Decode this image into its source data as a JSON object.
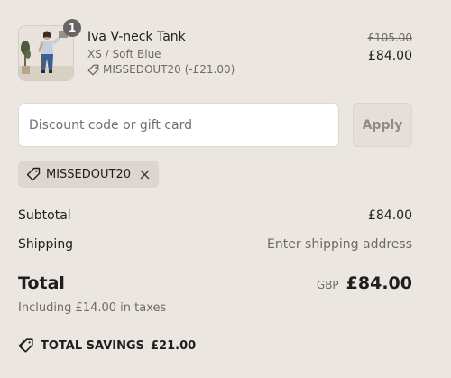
{
  "product": {
    "name": "Iva V-neck Tank",
    "variant": "XS / Soft Blue",
    "discount_applied": "MISSEDOUT20 (-£21.00)",
    "compare_at_price": "£105.00",
    "price": "£84.00",
    "quantity": "1",
    "image_alt": "Iva V-neck Tank product photo",
    "icons": [
      "tag-icon"
    ]
  },
  "discount": {
    "placeholder": "Discount code or gift card",
    "value": "",
    "apply_label": "Apply",
    "applied_code": "MISSEDOUT20",
    "icons": [
      "tag-icon",
      "close-icon"
    ]
  },
  "summary": {
    "subtotal_label": "Subtotal",
    "subtotal_value": "£84.00",
    "shipping_label": "Shipping",
    "shipping_value": "Enter shipping address",
    "total_label": "Total",
    "currency": "GBP",
    "total_value": "£84.00",
    "tax_note": "Including £14.00 in taxes",
    "savings_label": "TOTAL SAVINGS",
    "savings_value": "£21.00",
    "icons": [
      "savings-tag-icon"
    ]
  },
  "colors": {
    "page_background": "#ece6e1",
    "text_primary": "#1e1e1e",
    "text_muted": "#6f6a66",
    "badge": "#666564",
    "tag_background": "#ddd6d0"
  }
}
